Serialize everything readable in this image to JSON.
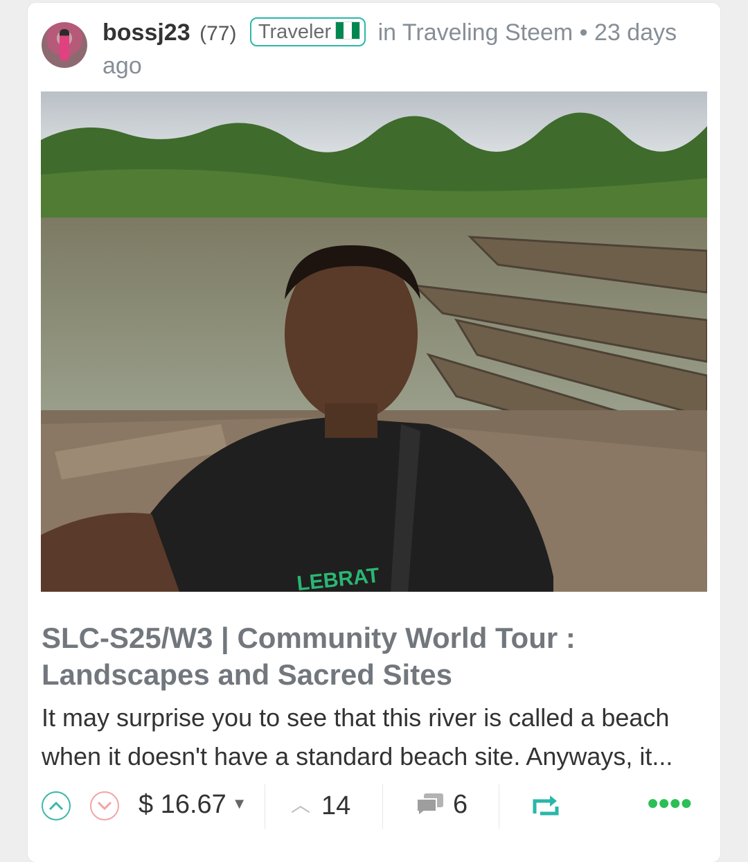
{
  "post": {
    "author": "bossj23",
    "reputation": "(77)",
    "badge_label": "Traveler",
    "community_text": "in Traveling Steem",
    "separator": "•",
    "time_ago": "23 days ago",
    "title": "SLC-S25/W3 | Community World Tour : Landscapes and Sacred Sites",
    "excerpt": "It may surprise you to see that this river is called a beach when it doesn't have a standard beach site. Anyways, it...",
    "payout": "$ 16.67",
    "vote_count": "14",
    "comment_count": "6"
  },
  "colors": {
    "accent": "#2ab7a9",
    "downvote": "#f1a5a5",
    "more": "#2cbf55",
    "title": "#72777d"
  },
  "icons": {
    "upvote": "chevron-up-circle-icon",
    "downvote": "chevron-down-circle-icon",
    "payout_dropdown": "caret-down-icon",
    "votes": "chevron-up-icon",
    "comments": "comment-bubble-icon",
    "reblog": "reblog-icon",
    "more": "more-dots-icon",
    "flag": "nigeria-flag-icon"
  }
}
